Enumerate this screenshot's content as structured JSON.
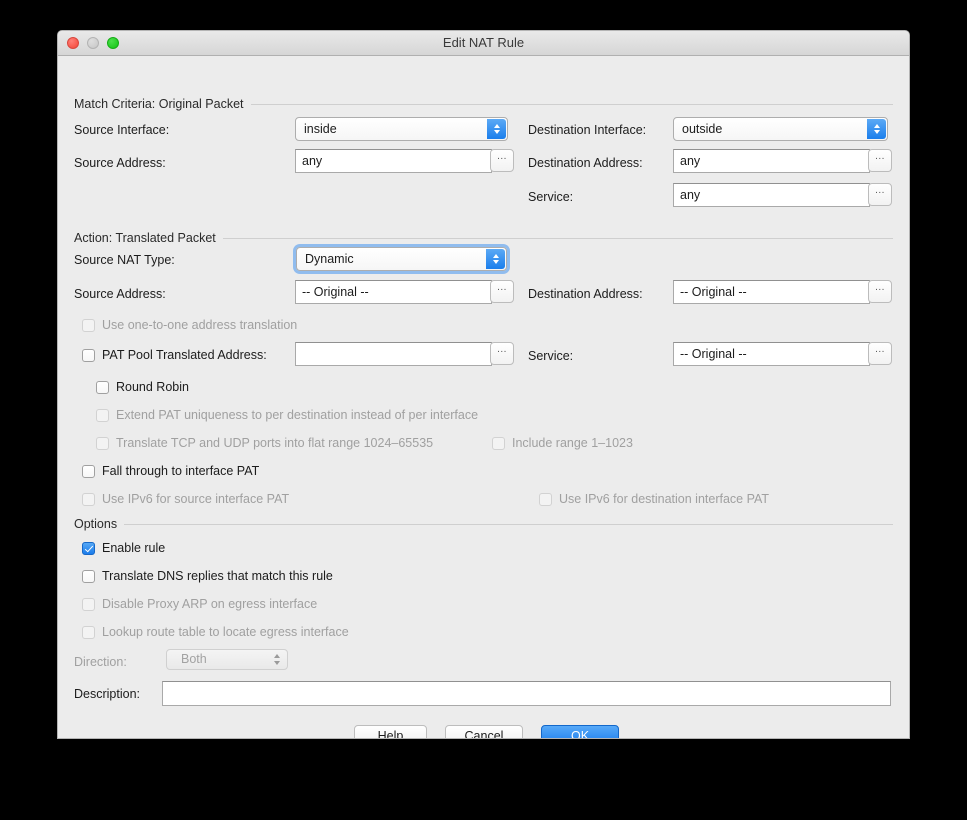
{
  "window": {
    "title": "Edit NAT Rule",
    "traffic_lights": [
      "close",
      "minimize",
      "zoom"
    ]
  },
  "sections": {
    "match_criteria": {
      "header": "Match Criteria: Original Packet",
      "source_interface_label": "Source Interface:",
      "source_interface_value": "inside",
      "destination_interface_label": "Destination Interface:",
      "destination_interface_value": "outside",
      "source_address_label": "Source Address:",
      "source_address_value": "any",
      "destination_address_label": "Destination Address:",
      "destination_address_value": "any",
      "service_label": "Service:",
      "service_value": "any",
      "browse_button": "..."
    },
    "action": {
      "header": "Action: Translated Packet",
      "source_nat_type_label": "Source NAT Type:",
      "source_nat_type_value": "Dynamic",
      "source_address_label": "Source Address:",
      "source_address_value": "-- Original --",
      "destination_address_label": "Destination Address:",
      "destination_address_value": "-- Original --",
      "one_to_one_label": "Use one-to-one address translation",
      "pat_pool_label": "PAT Pool Translated Address:",
      "pat_pool_value": "",
      "service_label": "Service:",
      "service_value": "-- Original --",
      "round_robin_label": "Round Robin",
      "extend_pat_label": "Extend PAT uniqueness to per destination instead of per interface",
      "flat_range_label": "Translate TCP and UDP ports into flat range 1024–65535",
      "include_range_label": "Include range 1–1023",
      "fall_through_label": "Fall through to interface PAT",
      "ipv6_source_label": "Use IPv6 for source interface PAT",
      "ipv6_destination_label": "Use IPv6 for destination interface PAT"
    },
    "options": {
      "header": "Options",
      "enable_rule_label": "Enable rule",
      "translate_dns_label": "Translate DNS replies that match this rule",
      "disable_proxy_arp_label": "Disable Proxy ARP on egress interface",
      "lookup_route_label": "Lookup route table to locate egress interface",
      "direction_label": "Direction:",
      "direction_value": "Both",
      "description_label": "Description:",
      "description_value": ""
    }
  },
  "footer": {
    "help_label": "Help",
    "cancel_label": "Cancel",
    "ok_label": "OK"
  },
  "colors": {
    "accent": "#1679ec",
    "window_bg": "#ececec",
    "disabled_text": "#a0a0a0"
  }
}
